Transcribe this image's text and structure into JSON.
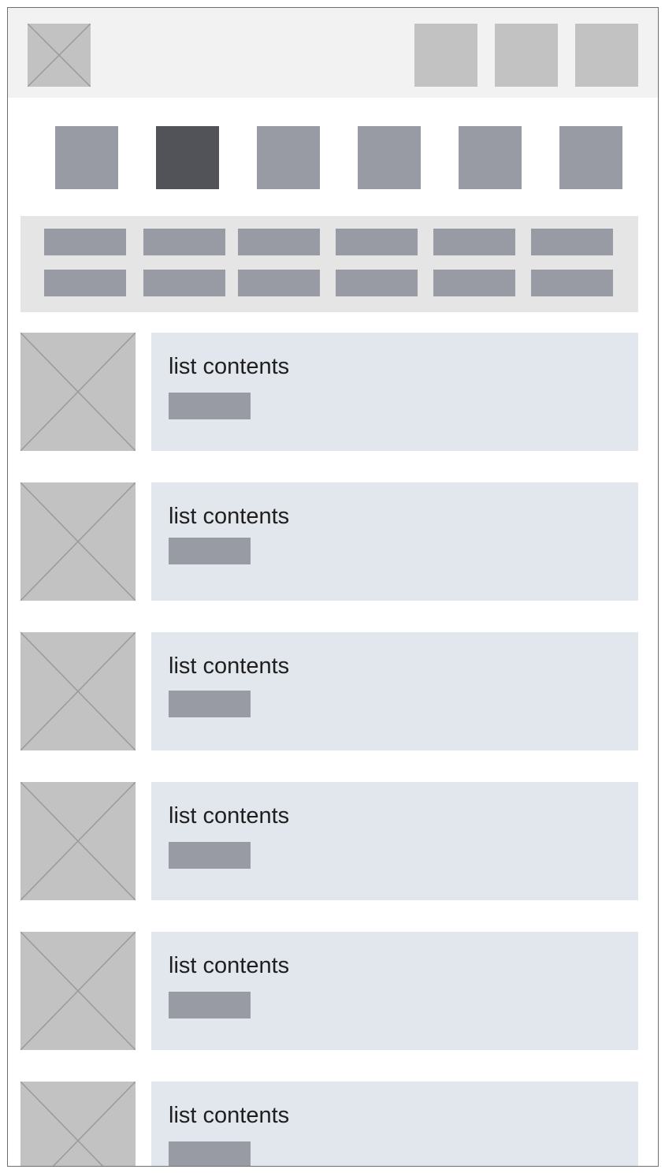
{
  "header": {
    "logo_icon": "image-placeholder-icon",
    "actions": [
      "header-action-1",
      "header-action-2",
      "header-action-3"
    ]
  },
  "categories": {
    "count": 6,
    "active_index": 1,
    "colors": {
      "default": "#989ba3",
      "active": "#515358"
    }
  },
  "filters": {
    "rows": 2,
    "per_row": 6
  },
  "list": {
    "thumbnail_icon": "image-placeholder-icon",
    "items": [
      {
        "title": "list contents"
      },
      {
        "title": "list contents"
      },
      {
        "title": "list contents"
      },
      {
        "title": "list contents"
      },
      {
        "title": "list contents"
      },
      {
        "title": "list contents"
      }
    ]
  }
}
